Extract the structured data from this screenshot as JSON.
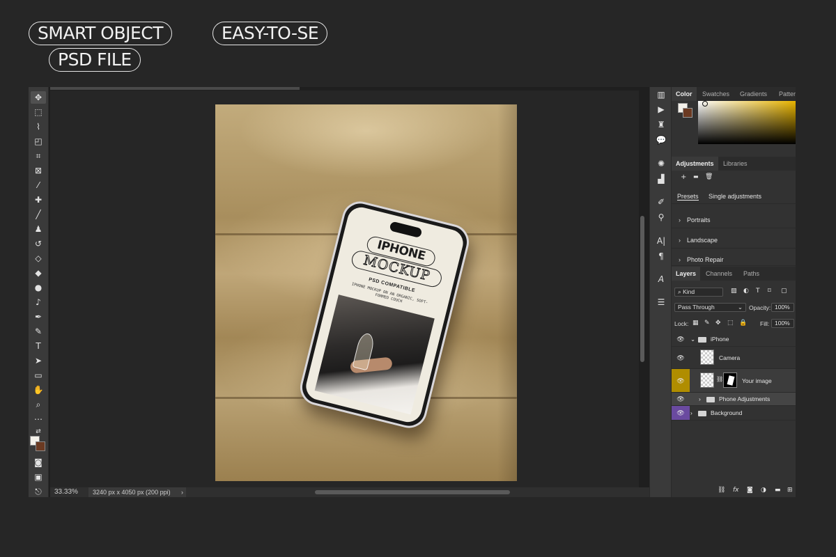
{
  "badges": {
    "smart_object": "SMART OBJECT",
    "easy_to_use": "EASY-TO-SE",
    "psd_file": "PSD FILE"
  },
  "mockup": {
    "title_line1": "IPHONE",
    "title_line2": "MOCKUP",
    "subtitle": "PSD COMPATIBLE",
    "description": "IPHONE MOCKUP ON AN ORGANIC, SOFT-FORMED COUCH"
  },
  "status": {
    "zoom": "33.33%",
    "doc_size": "3240 px x 4050 px (200 ppi)",
    "chevron": "›"
  },
  "color_panel": {
    "tabs": [
      "Color",
      "Swatches",
      "Gradients",
      "Patter"
    ],
    "colors": {
      "foreground": "#f4f1ea",
      "background": "#6b3a22",
      "hue": "#e8b400"
    }
  },
  "adjustments_panel": {
    "tabs": [
      "Adjustments",
      "Libraries"
    ],
    "tools": [
      "+",
      "▬",
      "🗑"
    ],
    "subtabs": [
      "Presets",
      "Single adjustments"
    ],
    "presets": [
      "Portraits",
      "Landscape",
      "Photo Repair"
    ]
  },
  "layers_panel": {
    "tabs": [
      "Layers",
      "Channels",
      "Paths"
    ],
    "filter_label": "Kind",
    "blend_mode": "Pass Through",
    "opacity_label": "Opacity:",
    "opacity_value": "100%",
    "lock_label": "Lock:",
    "fill_label": "Fill:",
    "fill_value": "100%",
    "layers": [
      {
        "name": "iPhone",
        "type": "group",
        "expanded": true
      },
      {
        "name": "Camera",
        "type": "layer"
      },
      {
        "name": "Your image",
        "type": "smart-object",
        "eye_color": "#b08d00"
      },
      {
        "name": "Phone Adjustments",
        "type": "group",
        "expanded": false
      },
      {
        "name": "Background",
        "type": "group",
        "expanded": false,
        "eye_color": "#6a4aa0"
      }
    ],
    "bottom_tools": [
      "link-icon",
      "fx-icon",
      "mask-icon",
      "adjustment-icon",
      "folder-icon",
      "new-layer-icon"
    ]
  },
  "toolbar": {
    "tools": [
      "move-icon",
      "marquee-icon",
      "lasso-icon",
      "object-select-icon",
      "crop-icon",
      "frame-icon",
      "eyedropper-icon",
      "healing-icon",
      "brush-icon",
      "stamp-icon",
      "history-brush-icon",
      "eraser-icon",
      "paint-bucket-icon",
      "blur-icon",
      "dodge-icon",
      "pen-icon",
      "type-icon",
      "path-select-icon",
      "rectangle-icon",
      "hand-icon",
      "zoom-icon",
      "more-icon"
    ]
  }
}
